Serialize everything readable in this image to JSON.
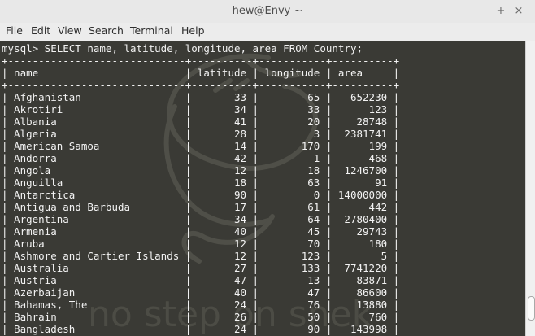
{
  "window": {
    "title": "hew@Envy ~"
  },
  "menubar": {
    "items": [
      "File",
      "Edit",
      "View",
      "Search",
      "Terminal",
      "Help"
    ]
  },
  "terminal": {
    "command": "mysql> SELECT name, latitude, longitude, area FROM Country;",
    "columns": [
      "name",
      "latitude",
      "longitude",
      "area"
    ],
    "rows": [
      [
        "Afghanistan",
        "33",
        "65",
        "652230"
      ],
      [
        "Akrotiri",
        "34",
        "33",
        "123"
      ],
      [
        "Albania",
        "41",
        "20",
        "28748"
      ],
      [
        "Algeria",
        "28",
        "3",
        "2381741"
      ],
      [
        "American Samoa",
        "14",
        "170",
        "199"
      ],
      [
        "Andorra",
        "42",
        "1",
        "468"
      ],
      [
        "Angola",
        "12",
        "18",
        "1246700"
      ],
      [
        "Anguilla",
        "18",
        "63",
        "91"
      ],
      [
        "Antarctica",
        "90",
        "0",
        "14000000"
      ],
      [
        "Antigua and Barbuda",
        "17",
        "61",
        "442"
      ],
      [
        "Argentina",
        "34",
        "64",
        "2780400"
      ],
      [
        "Armenia",
        "40",
        "45",
        "29743"
      ],
      [
        "Aruba",
        "12",
        "70",
        "180"
      ],
      [
        "Ashmore and Cartier Islands",
        "12",
        "123",
        "5"
      ],
      [
        "Australia",
        "27",
        "133",
        "7741220"
      ],
      [
        "Austria",
        "47",
        "13",
        "83871"
      ],
      [
        "Azerbaijan",
        "40",
        "47",
        "86600"
      ],
      [
        "Bahamas, The",
        "24",
        "76",
        "13880"
      ],
      [
        "Bahrain",
        "26",
        "50",
        "760"
      ],
      [
        "Bangladesh",
        "24",
        "90",
        "143998"
      ]
    ],
    "watermark_text": "no step on snek"
  },
  "colors": {
    "terminal_bg": "#3a3a35",
    "terminal_fg": "#f2f2f2",
    "titlebar_bg": "#e8e8e8",
    "menubar_bg": "#ececec"
  },
  "icons": {
    "minimize": "minimize-icon",
    "maximize": "maximize-icon",
    "close": "close-icon"
  }
}
